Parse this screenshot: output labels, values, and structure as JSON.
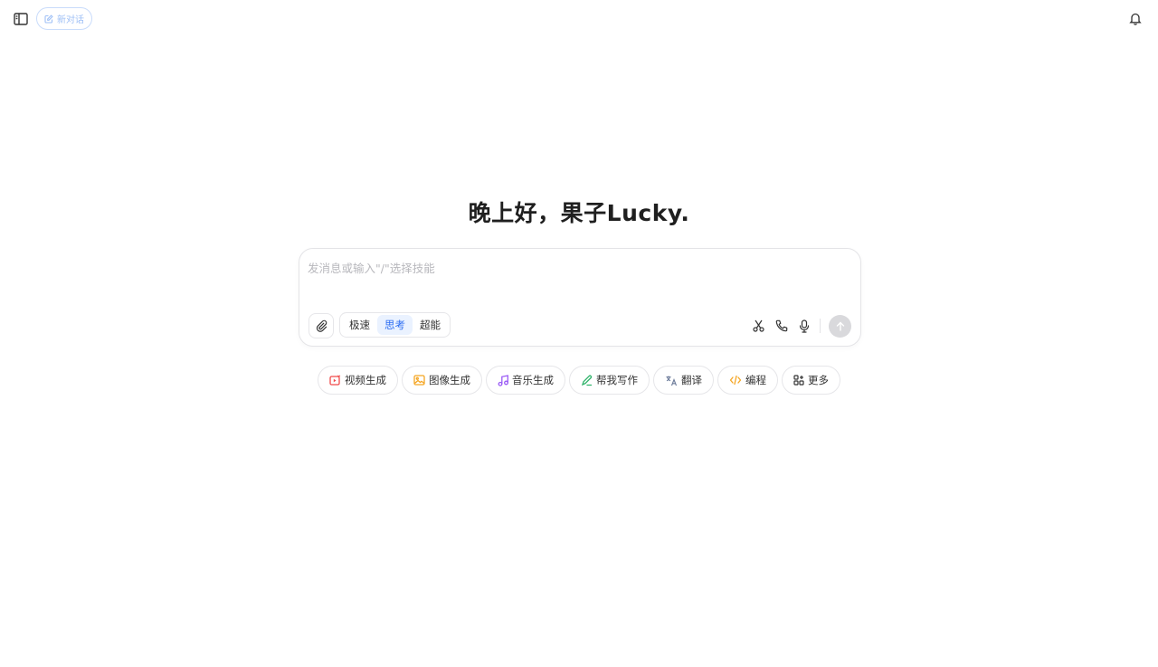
{
  "header": {
    "new_chat_label": "新对话"
  },
  "greeting": "晚上好，果子Lucky.",
  "composer": {
    "placeholder": "发消息或输入\"/\"选择技能",
    "modes": [
      {
        "label": "极速",
        "active": false
      },
      {
        "label": "思考",
        "active": true
      },
      {
        "label": "超能",
        "active": false
      }
    ]
  },
  "chips": [
    {
      "label": "视频生成",
      "icon": "video-icon",
      "color": "#f04b4b"
    },
    {
      "label": "图像生成",
      "icon": "image-icon",
      "color": "#f5a623"
    },
    {
      "label": "音乐生成",
      "icon": "music-icon",
      "color": "#9b5cf5"
    },
    {
      "label": "帮我写作",
      "icon": "pen-icon",
      "color": "#2fb36a"
    },
    {
      "label": "翻译",
      "icon": "translate-icon",
      "color": "#6b7a99"
    },
    {
      "label": "编程",
      "icon": "code-icon",
      "color": "#f5a623"
    },
    {
      "label": "更多",
      "icon": "grid-plus-icon",
      "color": "#333333"
    }
  ],
  "colors": {
    "accent": "#2a6cf2",
    "mode_active_bg": "#eaf2ff",
    "send_disabled": "#d9d9dc"
  }
}
